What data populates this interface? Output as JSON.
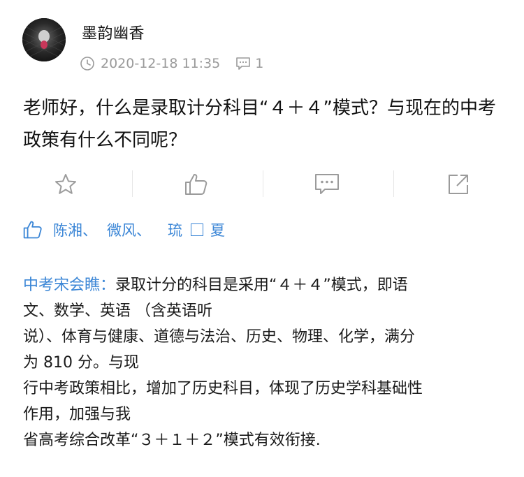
{
  "post": {
    "username": "墨韵幽香",
    "timestamp": "2020-12-18 11:35",
    "comment_count": "1",
    "question": "老师好，什么是录取计分科目“４＋４”模式？与现在的中考政策有什么不同呢？"
  },
  "icons": {
    "clock": "clock-icon",
    "comment": "comment-icon",
    "star": "star-icon",
    "like": "thumbs-up-icon",
    "reply": "message-icon",
    "share": "share-icon",
    "liked": "thumbs-up-icon"
  },
  "likes": {
    "names": [
      "陈湘、",
      "微风、",
      "琉",
      "夏"
    ]
  },
  "reply": {
    "author": "中考宋会瞧：",
    "lines": [
      "录取计分的科目是采用“４＋４”模式，即语",
      "文、数学、英语 （含英语听",
      "说）、体育与健康、道德与法治、历史、物理、化学，满分",
      "为 810 分。与现",
      "行中考政策相比，增加了历史科目，体现了历史学科基础性",
      "作用，加强与我",
      "省高考综合改革“３＋１＋２”模式有效衔接."
    ]
  },
  "colors": {
    "link_blue": "#3b86d6",
    "meta_gray": "#9a9a9a",
    "icon_gray": "#9b9b9b"
  }
}
